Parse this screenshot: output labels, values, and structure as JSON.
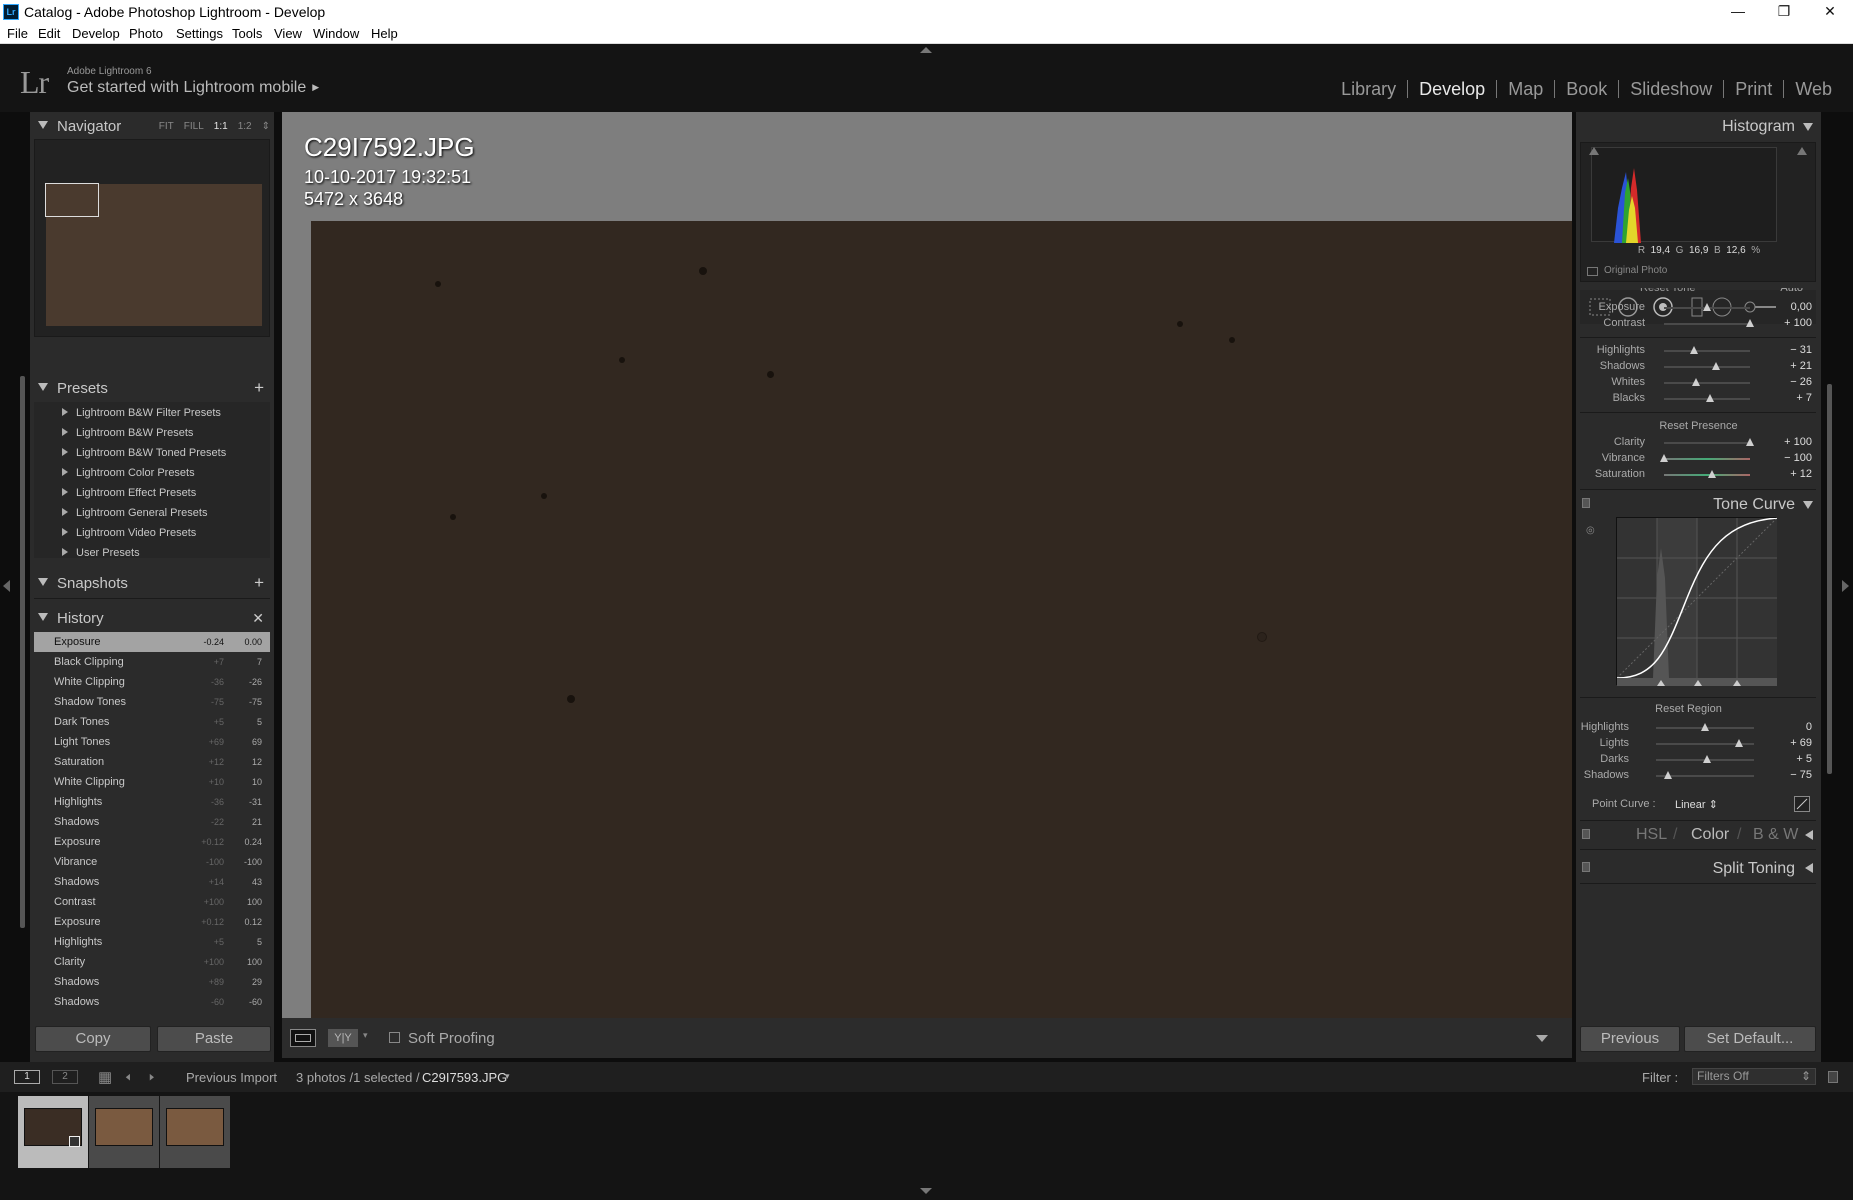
{
  "window": {
    "title": "Catalog - Adobe Photoshop Lightroom - Develop",
    "app_icon": "Lr"
  },
  "menu": [
    "File",
    "Edit",
    "Develop",
    "Photo",
    "Settings",
    "Tools",
    "View",
    "Window",
    "Help"
  ],
  "identity": {
    "logo": "Lr",
    "version": "Adobe Lightroom 6",
    "mobile": "Get started with Lightroom mobile"
  },
  "modules": [
    "Library",
    "Develop",
    "Map",
    "Book",
    "Slideshow",
    "Print",
    "Web"
  ],
  "active_module": "Develop",
  "navigator": {
    "title": "Navigator",
    "options": [
      "FIT",
      "FILL",
      "1:1",
      "1:2"
    ],
    "active_option": "1:1"
  },
  "presets": {
    "title": "Presets",
    "items": [
      "Lightroom B&W Filter Presets",
      "Lightroom B&W Presets",
      "Lightroom B&W Toned Presets",
      "Lightroom Color Presets",
      "Lightroom Effect Presets",
      "Lightroom General Presets",
      "Lightroom Video Presets",
      "User Presets"
    ]
  },
  "snapshots": {
    "title": "Snapshots"
  },
  "history": {
    "title": "History",
    "items": [
      {
        "name": "Exposure",
        "v1": "-0.24",
        "v2": "0.00",
        "selected": true
      },
      {
        "name": "Black Clipping",
        "v1": "+7",
        "v2": "7"
      },
      {
        "name": "White Clipping",
        "v1": "-36",
        "v2": "-26"
      },
      {
        "name": "Shadow Tones",
        "v1": "-75",
        "v2": "-75"
      },
      {
        "name": "Dark Tones",
        "v1": "+5",
        "v2": "5"
      },
      {
        "name": "Light Tones",
        "v1": "+69",
        "v2": "69"
      },
      {
        "name": "Saturation",
        "v1": "+12",
        "v2": "12"
      },
      {
        "name": "White Clipping",
        "v1": "+10",
        "v2": "10"
      },
      {
        "name": "Highlights",
        "v1": "-36",
        "v2": "-31"
      },
      {
        "name": "Shadows",
        "v1": "-22",
        "v2": "21"
      },
      {
        "name": "Exposure",
        "v1": "+0.12",
        "v2": "0.24"
      },
      {
        "name": "Vibrance",
        "v1": "-100",
        "v2": "-100"
      },
      {
        "name": "Shadows",
        "v1": "+14",
        "v2": "43"
      },
      {
        "name": "Contrast",
        "v1": "+100",
        "v2": "100"
      },
      {
        "name": "Exposure",
        "v1": "+0.12",
        "v2": "0.12"
      },
      {
        "name": "Highlights",
        "v1": "+5",
        "v2": "5"
      },
      {
        "name": "Clarity",
        "v1": "+100",
        "v2": "100"
      },
      {
        "name": "Shadows",
        "v1": "+89",
        "v2": "29"
      },
      {
        "name": "Shadows",
        "v1": "-60",
        "v2": "-60"
      }
    ]
  },
  "left_buttons": {
    "copy": "Copy",
    "paste": "Paste"
  },
  "photo_info": {
    "filename": "C29I7592.JPG",
    "datetime": "10-10-2017 19:32:51",
    "dimensions": "5472 x 3648"
  },
  "toolbar": {
    "soft_proofing": "Soft Proofing",
    "compare": "Y|Y"
  },
  "histogram": {
    "title": "Histogram",
    "r_label": "R",
    "r": "19,4",
    "g_label": "G",
    "g": "16,9",
    "b_label": "B",
    "b": "12,6",
    "unit": "%",
    "original_photo": "Original Photo"
  },
  "basic": {
    "reset_tone": "Reset Tone",
    "auto": "Auto",
    "reset_presence": "Reset Presence",
    "sliders": [
      {
        "label": "Exposure",
        "value": "0,00",
        "pos": 0.5
      },
      {
        "label": "Contrast",
        "value": "+ 100",
        "pos": 1.0
      },
      {
        "label": "Highlights",
        "value": "− 31",
        "pos": 0.35
      },
      {
        "label": "Shadows",
        "value": "+ 21",
        "pos": 0.6
      },
      {
        "label": "Whites",
        "value": "− 26",
        "pos": 0.37
      },
      {
        "label": "Blacks",
        "value": "+ 7",
        "pos": 0.53
      },
      {
        "label": "Clarity",
        "value": "+ 100",
        "pos": 1.0
      },
      {
        "label": "Vibrance",
        "value": "− 100",
        "pos": 0.0
      },
      {
        "label": "Saturation",
        "value": "+ 12",
        "pos": 0.56
      }
    ]
  },
  "tone_curve": {
    "title": "Tone Curve",
    "reset_region": "Reset Region",
    "sliders": [
      {
        "label": "Highlights",
        "value": "0",
        "pos": 0.5
      },
      {
        "label": "Lights",
        "value": "+ 69",
        "pos": 0.845
      },
      {
        "label": "Darks",
        "value": "+ 5",
        "pos": 0.525
      },
      {
        "label": "Shadows",
        "value": "− 75",
        "pos": 0.125
      }
    ],
    "point_curve_label": "Point Curve :",
    "point_curve_value": "Linear"
  },
  "hsl": {
    "hsl": "HSL",
    "color": "Color",
    "bw": "B & W",
    "sep": "/"
  },
  "split_toning": {
    "title": "Split Toning"
  },
  "right_buttons": {
    "previous": "Previous",
    "set_default": "Set Default..."
  },
  "filmstrip": {
    "page1": "1",
    "page2": "2",
    "source": "Previous Import",
    "count": "3 photos /1 selected /",
    "selected_file": "C29I7593.JPG",
    "filter_label": "Filter :",
    "filter_value": "Filters Off"
  },
  "colors": {
    "accent": "#e8e8e8",
    "panel": "#2b2b2b",
    "photo": "#322820",
    "thumb": "#7a5a40"
  }
}
